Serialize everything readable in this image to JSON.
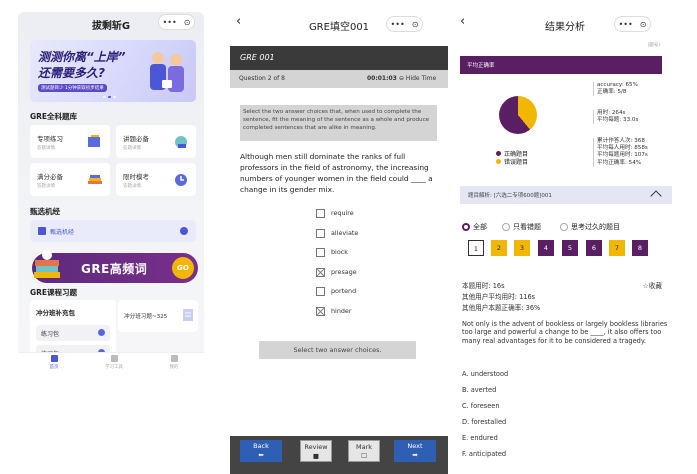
{
  "p1": {
    "title": "拔剩斩G",
    "capsule_more": "•••",
    "capsule_close": "⊙",
    "banner": {
      "line1": "测测你离“上岸”",
      "line2": "还需要多久?",
      "tag": "测试题目少 1分钟获取初步结果"
    },
    "section_bank": "GRE全科题库",
    "cards": [
      {
        "title": "专项练习",
        "sub": "答题详情"
      },
      {
        "title": "讲题必备",
        "sub": "答题详情"
      },
      {
        "title": "满分必备",
        "sub": "答题详情"
      },
      {
        "title": "限时模考",
        "sub": "答题详情"
      }
    ],
    "section_jing": "甄选机经",
    "jing_label": "甄选机经",
    "gre_banner": "GRE高频词",
    "go": "GO",
    "section_course": "GRE课程习题",
    "course_left_title": "冲分班补充包",
    "course_items": [
      "练习包",
      "练习包"
    ],
    "course_right_title": "冲分班习题~325",
    "tabs": [
      "首页",
      "学习工具",
      "我的"
    ]
  },
  "p2": {
    "nav_title": "GRE填空001",
    "header": "GRE 001",
    "question_no": "Question 2 of 8",
    "timer": "00:01:03",
    "hide_time": "⊖ Hide Time",
    "instruction": "Select the two answer choices that, when used to complete the sentence, fit the meaning of the sentence as a whole and produce completed sentences that are alike in meaning.",
    "question": "Although men still dominate the ranks of full professors in the field of astronomy, the increasing numbers of younger women in the field could ____ a change in its gender mix.",
    "options": [
      {
        "label": "require",
        "checked": false
      },
      {
        "label": "alleviate",
        "checked": false
      },
      {
        "label": "block",
        "checked": false
      },
      {
        "label": "presage",
        "checked": true
      },
      {
        "label": "portend",
        "checked": false
      },
      {
        "label": "hinder",
        "checked": true
      }
    ],
    "select_hint": "Select two answer choices.",
    "footer": {
      "back": "Back",
      "back_icon": "⬅",
      "review": "Review",
      "review_icon": "■",
      "mark": "Mark",
      "mark_icon": "☐",
      "next": "Next",
      "next_icon": "➡"
    }
  },
  "p3": {
    "nav_title": "结果分析",
    "small": "(题号)",
    "avg_label": "平均正确率",
    "legend": [
      "正确题目",
      "错误题目"
    ],
    "stats_a": [
      "accuracy: 65%",
      "正确率: 5/8"
    ],
    "stats_b": [
      "用时: 264s",
      "平均每题: 33.0s"
    ],
    "stats_c": [
      "累计作答人次: 368",
      "平均每人用时: 858s",
      "平均每题用时: 107s",
      "平均正确率: 54%"
    ],
    "analysis_bar": "题目解析: [六选二专项600题]001",
    "filters": [
      "全部",
      "只看错题",
      "思考过久的题目"
    ],
    "qnums": [
      "1",
      "2",
      "3",
      "4",
      "5",
      "6",
      "7",
      "8"
    ],
    "qcolors": [
      "#ffffff",
      "#f2b705",
      "#f2b705",
      "#5a1f63",
      "#5a1f63",
      "#5a1f63",
      "#f2b705",
      "#5a1f63"
    ],
    "info": [
      "本题用时: 16s",
      "其他用户平均用时: 116s",
      "其他用户本题正确率: 36%"
    ],
    "fav": "☆收藏",
    "passage": "Not only is the advent of bookless or largely bookless libraries too large and powerful a change to be ____, it also offers too many real advantages for it to be considered a tragedy.",
    "answers": [
      "A. understood",
      "B. averted",
      "C. foreseen",
      "D. forestalled",
      "E. endured",
      "F. anticipated"
    ]
  },
  "colors": {
    "purple": "#5a1f63",
    "yellow": "#f2b705",
    "blue": "#2f5fb5",
    "indigo": "#4b57d6"
  }
}
